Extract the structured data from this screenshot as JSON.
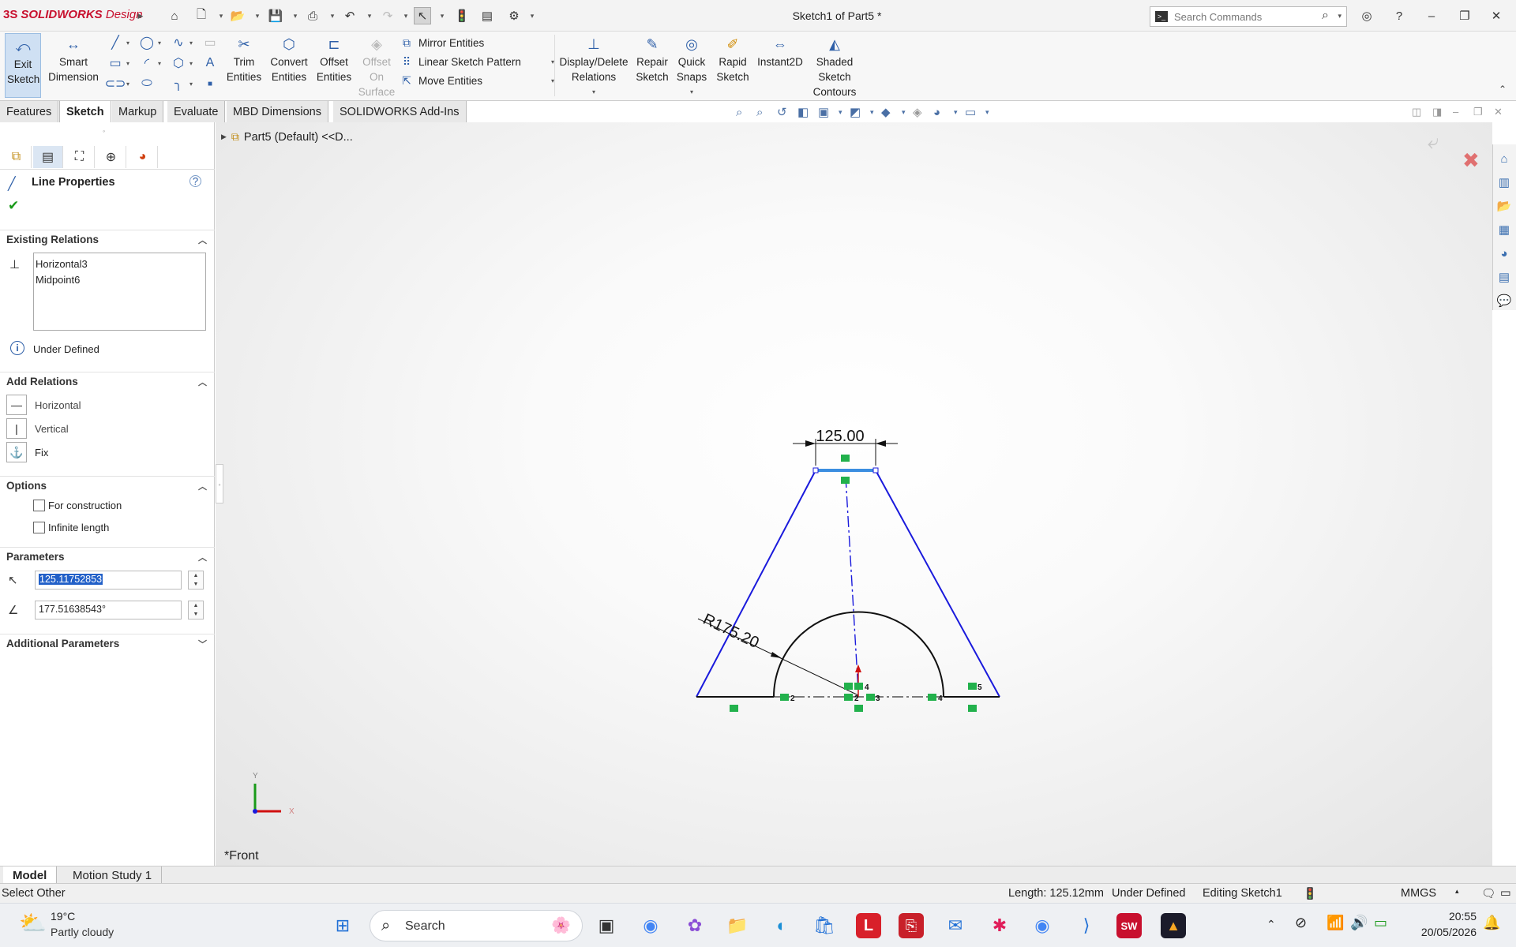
{
  "app": {
    "logo_ds": "3S",
    "logo_name": "SOLIDWORKS",
    "logo_suffix": "Design",
    "document_title": "Sketch1 of Part5 *",
    "search_placeholder": "Search Commands"
  },
  "ribbon": {
    "exit_sketch": "Exit Sketch",
    "smart_dimension": "Smart Dimension",
    "trim_entities": "Trim Entities",
    "convert_entities": "Convert Entities",
    "offset_entities": "Offset Entities",
    "offset_on_surface": "Offset On Surface",
    "mirror_entities": "Mirror Entities",
    "linear_sketch_pattern": "Linear Sketch Pattern",
    "move_entities": "Move Entities",
    "display_delete_relations": "Display/Delete Relations",
    "repair_sketch": "Repair Sketch",
    "quick_snaps": "Quick Snaps",
    "rapid_sketch": "Rapid Sketch",
    "instant2d": "Instant2D",
    "shaded_sketch_contours": "Shaded Sketch Contours"
  },
  "tabs": [
    "Features",
    "Sketch",
    "Markup",
    "Evaluate",
    "MBD Dimensions",
    "SOLIDWORKS Add-Ins"
  ],
  "active_tab": "Sketch",
  "tree": {
    "part_label": "Part5 (Default) <<D..."
  },
  "property_manager": {
    "title": "Line Properties",
    "existing_relations": {
      "header": "Existing Relations",
      "items": [
        "Horizontal3",
        "Midpoint6"
      ],
      "status": "Under Defined"
    },
    "add_relations": {
      "header": "Add Relations",
      "items": [
        "Horizontal",
        "Vertical",
        "Fix"
      ]
    },
    "options": {
      "header": "Options",
      "for_construction": "For construction",
      "infinite_length": "Infinite length"
    },
    "parameters": {
      "header": "Parameters",
      "length_value": "125.11752853",
      "angle_value": "177.51638543°"
    },
    "additional_parameters": {
      "header": "Additional Parameters"
    }
  },
  "sketch": {
    "dimension_top": "125.00",
    "dimension_radius": "R175.20",
    "point_labels": [
      "2",
      "2",
      "3",
      "4",
      "4",
      "5"
    ],
    "axis_x": "X",
    "axis_y": "Y",
    "view_label": "*Front"
  },
  "model_tabs": [
    "Model",
    "Motion Study 1"
  ],
  "status": {
    "left": "Select Other",
    "length": "Length: 125.12mm",
    "defined": "Under Defined",
    "editing": "Editing Sketch1",
    "units": "MMGS"
  },
  "taskbar": {
    "weather_temp": "19°C",
    "weather_desc": "Partly cloudy",
    "search_placeholder": "Search",
    "time": "20:55",
    "date": "20/05/2026"
  },
  "colors": {
    "sketch_blue": "#1a1adc",
    "sketch_black": "#111111",
    "relation_green": "#22b14c",
    "selected_line": "#3b8ee0",
    "brand_red": "#c8102e"
  }
}
